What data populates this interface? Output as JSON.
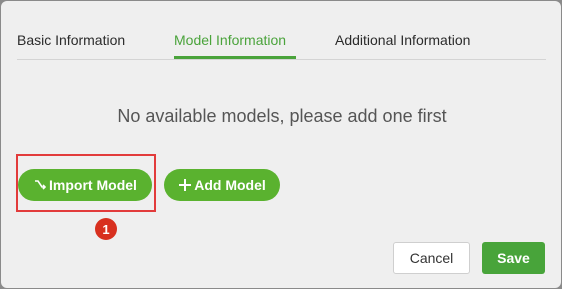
{
  "tabs": [
    {
      "label": "Basic Information",
      "active": false
    },
    {
      "label": "Model Information",
      "active": true
    },
    {
      "label": "Additional Information",
      "active": false
    }
  ],
  "empty_message": "No available models, please add one first",
  "actions": {
    "import_label": "Import Model",
    "import_icon": "import-icon",
    "add_label": "Add Model",
    "add_icon": "plus-icon"
  },
  "annotation": {
    "step_number": "1",
    "highlight_color": "#e23b3b"
  },
  "footer": {
    "cancel_label": "Cancel",
    "save_label": "Save"
  },
  "colors": {
    "accent": "#4aa33b",
    "button_green": "#5ab22f",
    "badge_red": "#d8301f"
  }
}
